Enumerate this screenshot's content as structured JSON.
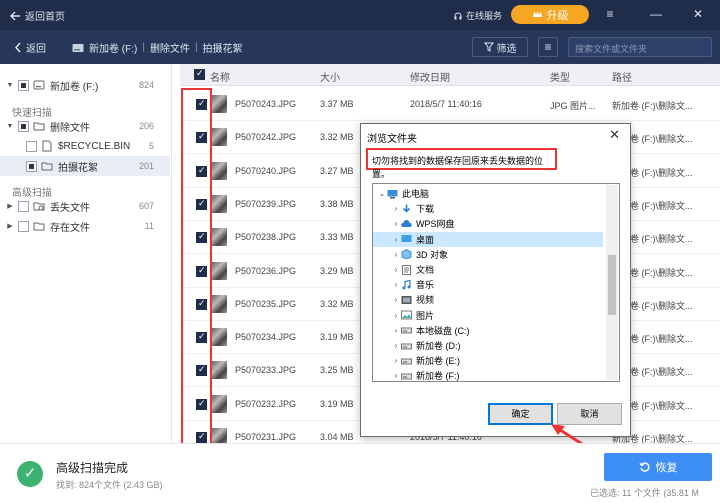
{
  "titlebar": {
    "home_label": "返回首页",
    "service_label": "在线服务",
    "upgrade_label": "升级"
  },
  "toolbar": {
    "back_label": "返回",
    "crumbs": [
      "新加卷 (F:)",
      "删除文件",
      "拍摄花絮"
    ],
    "filter_label": "筛选",
    "search_placeholder": "搜索文件或文件夹"
  },
  "sidebar": {
    "root": {
      "label": "新加卷 (F:)",
      "count": "824"
    },
    "quick_scan_label": "快速扫描",
    "deleted": {
      "label": "删除文件",
      "count": "206"
    },
    "recycle": {
      "label": "$RECYCLE.BIN",
      "count": "5"
    },
    "shoot": {
      "label": "拍摄花絮",
      "count": "201"
    },
    "advanced_label": "高级扫描",
    "lost": {
      "label": "丢失文件",
      "count": "607"
    },
    "existing": {
      "label": "存在文件",
      "count": "11"
    }
  },
  "list": {
    "headers": {
      "name": "名称",
      "size": "大小",
      "date": "修改日期",
      "type": "类型",
      "path": "路径"
    },
    "rows": [
      {
        "name": "P5070243.JPG",
        "size": "3.37 MB",
        "date": "2018/5/7 11:40:16",
        "type": "JPG 图片...",
        "path": "新加卷 (F:)\\删除文..."
      },
      {
        "name": "P5070242.JPG",
        "size": "3.32 MB",
        "date": "",
        "type": "",
        "path": "新加卷 (F:)\\删除文..."
      },
      {
        "name": "P5070240.JPG",
        "size": "3.27 MB",
        "date": "",
        "type": "",
        "path": "新加卷 (F:)\\删除文..."
      },
      {
        "name": "P5070239.JPG",
        "size": "3.38 MB",
        "date": "",
        "type": "",
        "path": "新加卷 (F:)\\删除文..."
      },
      {
        "name": "P5070238.JPG",
        "size": "3.33 MB",
        "date": "",
        "type": "",
        "path": "新加卷 (F:)\\删除文..."
      },
      {
        "name": "P5070236.JPG",
        "size": "3.29 MB",
        "date": "",
        "type": "",
        "path": "新加卷 (F:)\\删除文..."
      },
      {
        "name": "P5070235.JPG",
        "size": "3.32 MB",
        "date": "",
        "type": "",
        "path": "新加卷 (F:)\\删除文..."
      },
      {
        "name": "P5070234.JPG",
        "size": "3.19 MB",
        "date": "",
        "type": "",
        "path": "新加卷 (F:)\\删除文..."
      },
      {
        "name": "P5070233.JPG",
        "size": "3.25 MB",
        "date": "",
        "type": "",
        "path": "新加卷 (F:)\\删除文..."
      },
      {
        "name": "P5070232.JPG",
        "size": "3.19 MB",
        "date": "",
        "type": "",
        "path": "新加卷 (F:)\\删除文..."
      },
      {
        "name": "P5070231.JPG",
        "size": "3.04 MB",
        "date": "2018/5/7 11:40:16",
        "type": "",
        "path": "新加卷 (F:)\\删除文..."
      }
    ]
  },
  "dialog": {
    "title": "浏览文件夹",
    "message": "切勿将找到的数据保存回原来丢失数据的位置。",
    "tree": [
      {
        "label": "此电脑",
        "icon": "pc-icon"
      },
      {
        "label": "下载",
        "icon": "download-icon"
      },
      {
        "label": "WPS网盘",
        "icon": "cloud-icon"
      },
      {
        "label": "桌面",
        "icon": "desktop-icon"
      },
      {
        "label": "3D 对象",
        "icon": "cube-icon"
      },
      {
        "label": "文档",
        "icon": "document-icon"
      },
      {
        "label": "音乐",
        "icon": "music-icon"
      },
      {
        "label": "视频",
        "icon": "video-icon"
      },
      {
        "label": "图片",
        "icon": "picture-icon"
      },
      {
        "label": "本地磁盘 (C:)",
        "icon": "drive-icon"
      },
      {
        "label": "新加卷 (D:)",
        "icon": "drive-icon"
      },
      {
        "label": "新加卷 (E:)",
        "icon": "drive-icon"
      },
      {
        "label": "新加卷 (F:)",
        "icon": "drive-icon"
      }
    ],
    "ok_label": "确定",
    "cancel_label": "取消"
  },
  "footer": {
    "title": "高级扫描完成",
    "summary": "找到: 824个文件 (2.43 GB)",
    "recover_label": "恢复",
    "selected_info": "已选选: 11 个文件 (35.81 M"
  },
  "colors": {
    "titlebar": "#1f2d4a",
    "toolbar": "#27375a",
    "accent_upgrade": "#f5a623",
    "accent_recover": "#3e8ef7",
    "highlight_red": "#e33333",
    "success": "#3cb371"
  }
}
